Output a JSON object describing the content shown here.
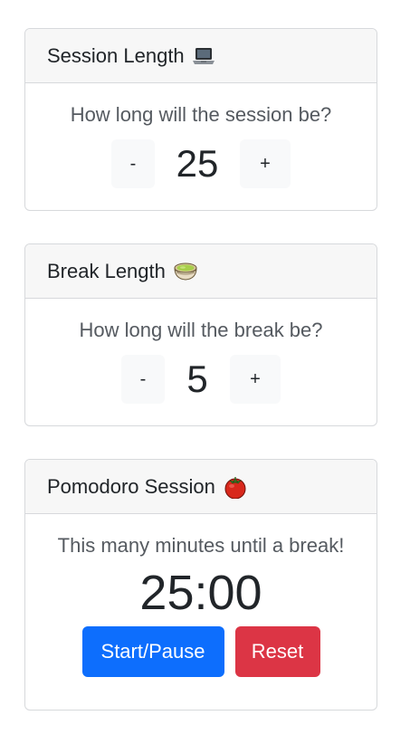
{
  "session": {
    "title": "Session Length",
    "icon": "laptop-icon",
    "question": "How long will the session be?",
    "decrement_label": "-",
    "increment_label": "+",
    "value": "25"
  },
  "break": {
    "title": "Break Length",
    "icon": "bowl-icon",
    "question": "How long will the break be?",
    "decrement_label": "-",
    "increment_label": "+",
    "value": "5"
  },
  "pomodoro": {
    "title": "Pomodoro Session",
    "icon": "tomato-icon",
    "status": "This many minutes until a break!",
    "time": "25:00",
    "start_pause_label": "Start/Pause",
    "reset_label": "Reset"
  },
  "colors": {
    "primary": "#0d6efd",
    "danger": "#dc3545",
    "header_bg": "#f7f7f7",
    "stepper_bg": "#f8f9fa"
  }
}
